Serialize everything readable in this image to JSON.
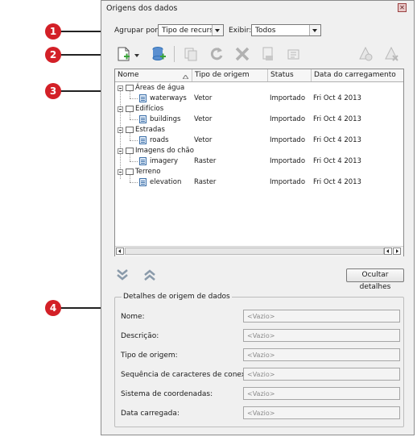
{
  "window": {
    "title": "Origens dos dados",
    "close_glyph": "✕"
  },
  "callouts": [
    "1",
    "2",
    "3",
    "4"
  ],
  "toolbar": {
    "group_by_label": "Agrupar por:",
    "group_by_value": "Tipo de recurso",
    "show_label": "Exibir:",
    "show_value": "Todos",
    "icons": [
      "new-data-source-icon",
      "add-data-source-icon",
      "copy-icon",
      "refresh-icon",
      "delete-icon",
      "import-icon",
      "properties-icon",
      "link-icon",
      "unlink-icon"
    ]
  },
  "grid": {
    "columns": [
      "Nome",
      "Tipo de origem",
      "Status",
      "Data do carregamento"
    ],
    "groups": [
      {
        "name": "Áreas de água",
        "items": [
          {
            "name": "waterways",
            "type": "Vetor",
            "status": "Importado",
            "date": "Fri Oct 4 2013"
          }
        ]
      },
      {
        "name": "Edifícios",
        "items": [
          {
            "name": "buildings",
            "type": "Vetor",
            "status": "Importado",
            "date": "Fri Oct 4 2013"
          }
        ]
      },
      {
        "name": "Estradas",
        "items": [
          {
            "name": "roads",
            "type": "Vetor",
            "status": "Importado",
            "date": "Fri Oct 4 2013"
          }
        ]
      },
      {
        "name": "Imagens do chão",
        "items": [
          {
            "name": "imagery",
            "type": "Raster",
            "status": "Importado",
            "date": "Fri Oct 4 2013"
          }
        ]
      },
      {
        "name": "Terreno",
        "items": [
          {
            "name": "elevation",
            "type": "Raster",
            "status": "Importado",
            "date": "Fri Oct 4 2013"
          }
        ]
      }
    ]
  },
  "actions": {
    "hide_details": "Ocultar detalhes"
  },
  "details": {
    "title": "Detalhes de origem de dados",
    "fields": [
      {
        "label": "Nome:",
        "value": "<Vazio>"
      },
      {
        "label": "Descrição:",
        "value": "<Vazio>"
      },
      {
        "label": "Tipo de origem:",
        "value": "<Vazio>"
      },
      {
        "label": "Sequência de caracteres de conexão:",
        "value": "<Vazio>"
      },
      {
        "label": "Sistema de coordenadas:",
        "value": "<Vazio>"
      },
      {
        "label": "Data carregada:",
        "value": "<Vazio>"
      }
    ]
  },
  "colors": {
    "callout": "#d32027",
    "accent_green": "#3aa33a",
    "icon_blue": "#2f6fb5"
  }
}
